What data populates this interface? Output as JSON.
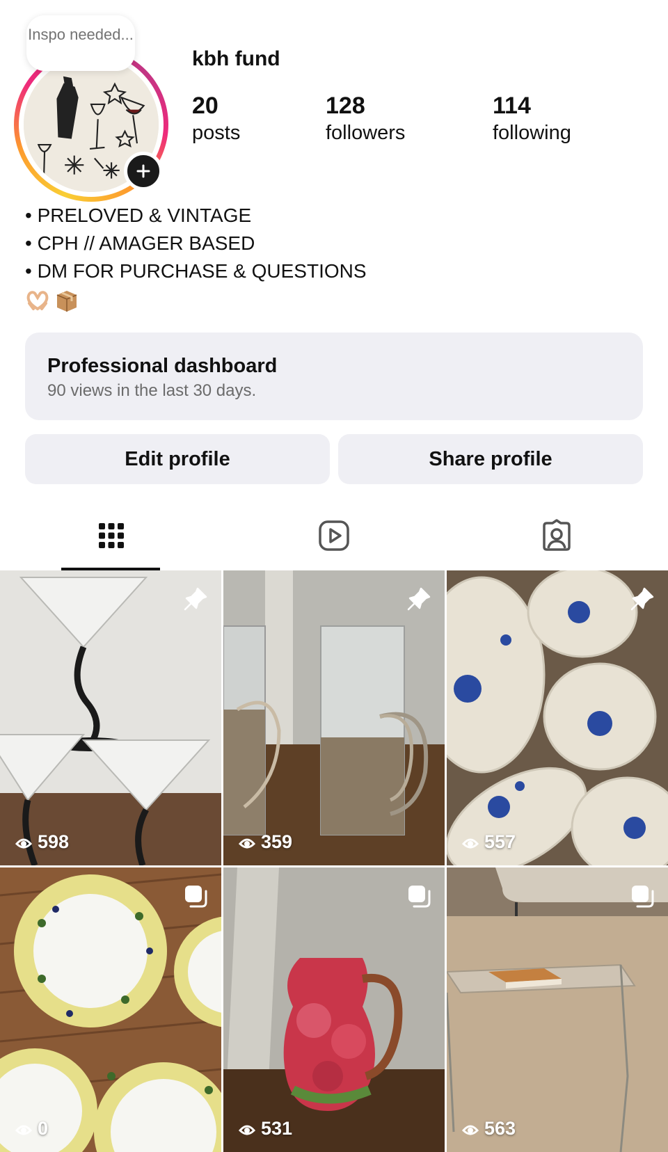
{
  "profile": {
    "note": "Inspo needed...",
    "username": "kbh fund",
    "stats": [
      {
        "value": "20",
        "label": "posts"
      },
      {
        "value": "128",
        "label": "followers"
      },
      {
        "value": "114",
        "label": "following"
      }
    ],
    "bio": [
      "• PRELOVED & VINTAGE",
      "• CPH // AMAGER BASED",
      "• DM FOR PURCHASE & QUESTIONS"
    ],
    "bio_emojis": [
      "heart-hands-icon",
      "package-icon"
    ]
  },
  "dashboard": {
    "title": "Professional dashboard",
    "subtitle": "90 views in the last 30 days."
  },
  "actions": {
    "edit_label": "Edit profile",
    "share_label": "Share profile"
  },
  "tabs": [
    {
      "icon": "grid-icon",
      "active": true
    },
    {
      "icon": "reels-icon",
      "active": false
    },
    {
      "icon": "tagged-icon",
      "active": false
    }
  ],
  "posts": [
    {
      "subject": "martini glasses",
      "badge": "pin-icon",
      "views": "598"
    },
    {
      "subject": "glass cups with metal holders",
      "badge": "pin-icon",
      "views": "359"
    },
    {
      "subject": "blue flower plates",
      "badge": "pin-icon",
      "views": "557"
    },
    {
      "subject": "olive pattern plates",
      "badge": "carousel-icon",
      "views": "0"
    },
    {
      "subject": "apple pitcher",
      "badge": "carousel-icon",
      "views": "531"
    },
    {
      "subject": "glass coffee table",
      "badge": "carousel-icon",
      "views": "563"
    }
  ],
  "colors": {
    "story_ring": [
      "#f9ce34",
      "#ee2a7b",
      "#c13584"
    ],
    "button_bg": "#efeff4",
    "text": "#111111",
    "muted": "#6b6b6b"
  }
}
